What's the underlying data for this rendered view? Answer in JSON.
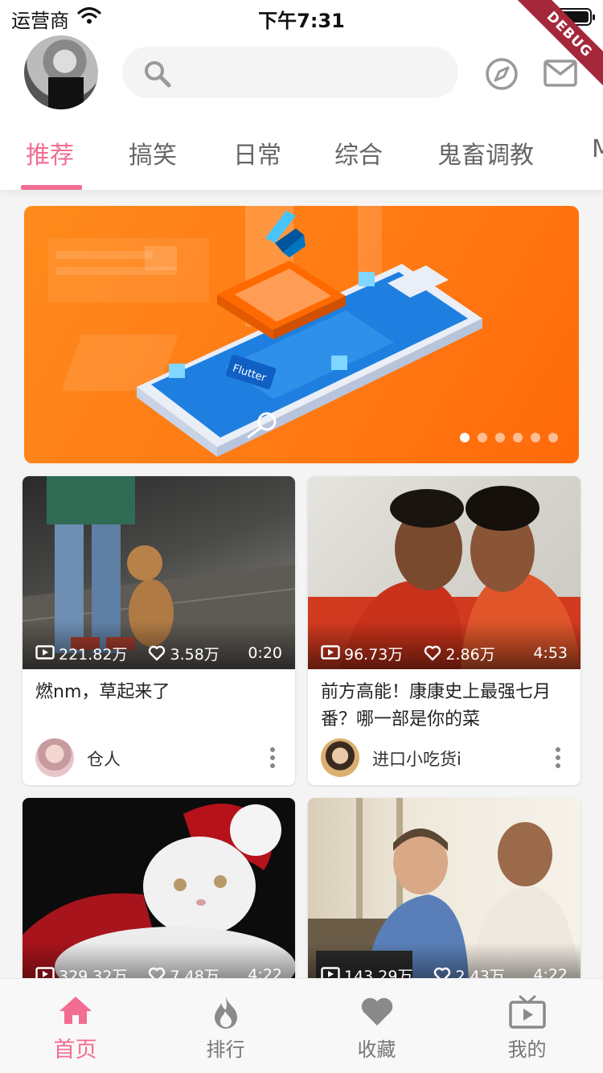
{
  "status_bar": {
    "carrier": "运营商",
    "time": "下午7:31"
  },
  "debug_label": "DEBUG",
  "header": {
    "search_placeholder": "",
    "tabs": [
      {
        "label": "推荐",
        "active": true
      },
      {
        "label": "搞笑"
      },
      {
        "label": "日常"
      },
      {
        "label": "综合"
      },
      {
        "label": "鬼畜调教"
      },
      {
        "label": "M"
      }
    ]
  },
  "banner": {
    "flutter_label": "Flutter",
    "dot_count": 6,
    "active_dot": 0
  },
  "cards": [
    {
      "views": "221.82万",
      "likes": "3.58万",
      "duration": "0:20",
      "title": "燃nm，草起来了",
      "user": "仓人"
    },
    {
      "views": "96.73万",
      "likes": "2.86万",
      "duration": "4:53",
      "title": "前方高能！康康史上最强七月番？哪一部是你的菜",
      "user": "进口小吃货i"
    },
    {
      "views": "329.32万",
      "likes": "7.48万",
      "duration": "4:22",
      "title": "",
      "user": ""
    },
    {
      "views": "143.29万",
      "likes": "2.43万",
      "duration": "4:22",
      "title": "",
      "user": ""
    }
  ],
  "bottom_nav": [
    {
      "label": "首页",
      "icon": "home-icon",
      "active": true
    },
    {
      "label": "排行",
      "icon": "fire-icon"
    },
    {
      "label": "收藏",
      "icon": "heart-icon"
    },
    {
      "label": "我的",
      "icon": "tv-icon"
    }
  ],
  "colors": {
    "accent": "#f26d92",
    "banner": "#ff7a14"
  }
}
